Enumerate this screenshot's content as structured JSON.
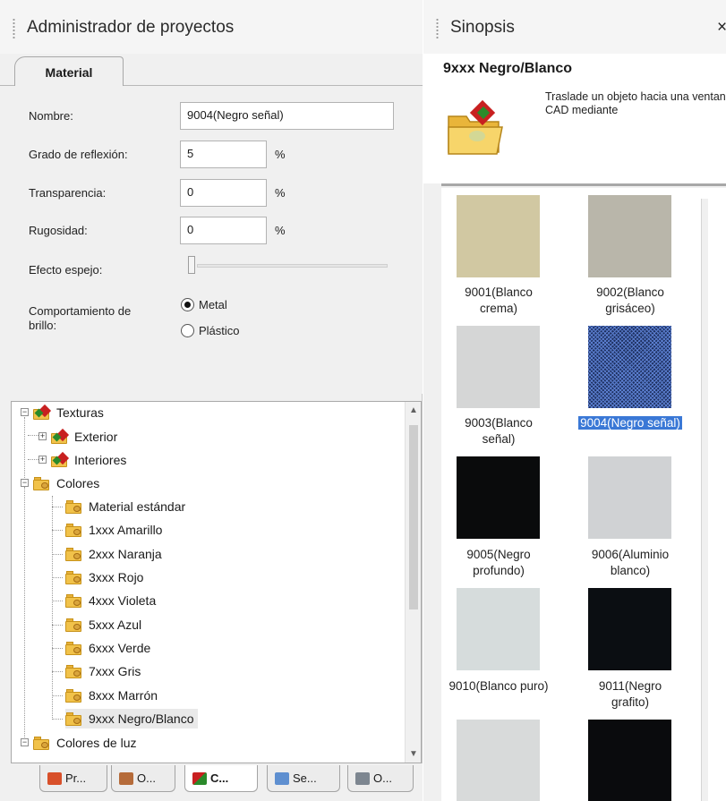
{
  "left_panel": {
    "title": "Administrador de proyectos",
    "tab": "Material",
    "form": {
      "name_label": "Nombre:",
      "name_value": "9004(Negro señal)",
      "reflection_label": "Grado de reflexión:",
      "reflection_value": "5",
      "transparency_label": "Transparencia:",
      "transparency_value": "0",
      "roughness_label": "Rugosidad:",
      "roughness_value": "0",
      "percent": "%",
      "mirror_label": "Efecto espejo:",
      "mirror_value": 0,
      "gloss_label_line1": "Comportamiento de",
      "gloss_label_line2": "brillo:",
      "gloss_options": [
        "Metal",
        "Plástico"
      ],
      "gloss_selected": "Metal"
    },
    "tree": {
      "items": [
        {
          "label": "Texturas",
          "icon": "texture-folder-icon",
          "expander": "−"
        },
        {
          "label": "Exterior",
          "icon": "texture-folder-icon",
          "expander": "+"
        },
        {
          "label": "Interiores",
          "icon": "texture-folder-icon",
          "expander": "+"
        },
        {
          "label": "Colores",
          "icon": "color-folder-icon",
          "expander": "−"
        },
        {
          "label": "Material estándar",
          "icon": "color-folder-icon"
        },
        {
          "label": "1xxx Amarillo",
          "icon": "color-folder-icon"
        },
        {
          "label": "2xxx Naranja",
          "icon": "color-folder-icon"
        },
        {
          "label": "3xxx Rojo",
          "icon": "color-folder-icon"
        },
        {
          "label": "4xxx Violeta",
          "icon": "color-folder-icon"
        },
        {
          "label": "5xxx Azul",
          "icon": "color-folder-icon"
        },
        {
          "label": "6xxx Verde",
          "icon": "color-folder-icon"
        },
        {
          "label": "7xxx Gris",
          "icon": "color-folder-icon"
        },
        {
          "label": "8xxx Marrón",
          "icon": "color-folder-icon"
        },
        {
          "label": "9xxx Negro/Blanco",
          "icon": "color-folder-icon",
          "selected": true
        },
        {
          "label": "Colores de luz",
          "icon": "color-folder-icon",
          "expander": "−"
        }
      ]
    },
    "bottom_tabs": [
      "Pr...",
      "O...",
      "C...",
      "Se...",
      "O..."
    ],
    "bottom_tab_icons": [
      "project-icon",
      "objects-icon",
      "catalog-icon",
      "settings-icon",
      "print-icon"
    ],
    "active_bottom_tab": "C..."
  },
  "right_panel": {
    "title": "Sinopsis",
    "close": "×",
    "info_title": "9xxx Negro/Blanco",
    "info_text": "Traslade un objeto hacia una ventana CAD mediante",
    "swatches": [
      {
        "label_line1": "9001(Blanco",
        "label_line2": "crema)",
        "color": "#d1c8a2"
      },
      {
        "label_line1": "9002(Blanco",
        "label_line2": "grisáceo)",
        "color": "#b9b6aa"
      },
      {
        "label_line1": "9003(Blanco",
        "label_line2": "señal)",
        "color": "#d5d6d6"
      },
      {
        "label_line1": "9004(Negro señal)",
        "label_line2": "",
        "color": "#1e3060",
        "selected": true
      },
      {
        "label_line1": "9005(Negro",
        "label_line2": "profundo)",
        "color": "#0a0b0c"
      },
      {
        "label_line1": "9006(Aluminio",
        "label_line2": "blanco)",
        "color": "#d0d2d4"
      },
      {
        "label_line1": "9010(Blanco puro)",
        "label_line2": "",
        "color": "#d6dcdc"
      },
      {
        "label_line1": "9011(Negro",
        "label_line2": "grafito)",
        "color": "#0b0e12"
      },
      {
        "label_line1": "",
        "label_line2": "",
        "color": "#d8dada"
      },
      {
        "label_line1": "",
        "label_line2": "",
        "color": "#0a0b0d"
      }
    ]
  }
}
